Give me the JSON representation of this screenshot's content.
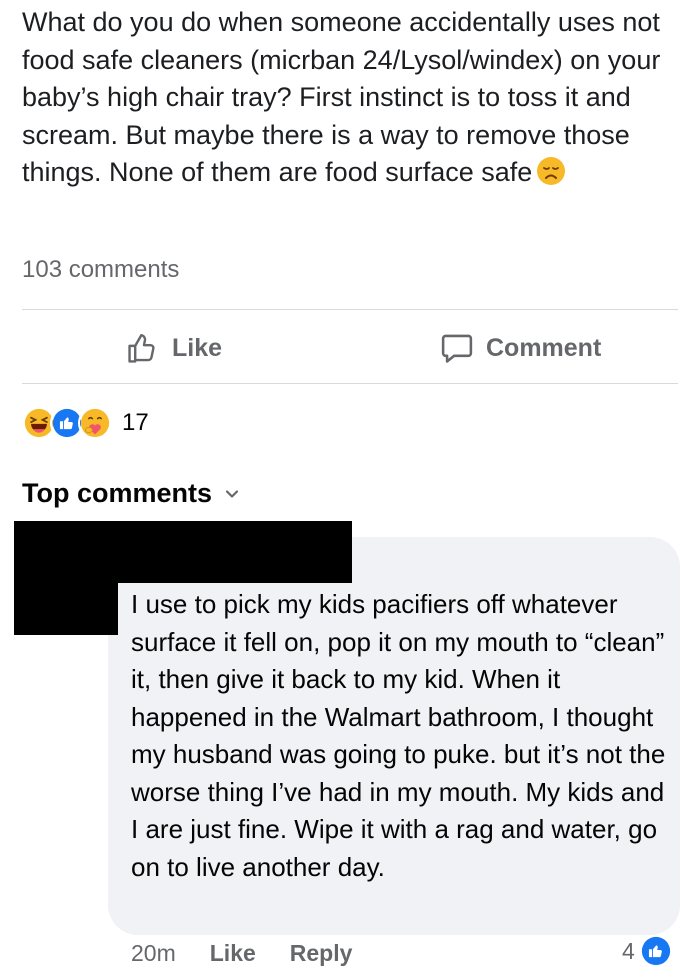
{
  "post": {
    "text": "What do you do when someone accidentally uses not food safe cleaners (micrban 24/Lysol/windex) on your baby’s high chair tray? First instinct is to toss it and scream. But maybe there is a way to remove those things. None of them are food surface safe",
    "emoji": "disappointed-face-emoji",
    "comment_count": "103 comments"
  },
  "actions": {
    "like_label": "Like",
    "comment_label": "Comment"
  },
  "reactions": {
    "icons": [
      "haha-reaction-icon",
      "like-reaction-icon",
      "care-reaction-icon"
    ],
    "count": "17"
  },
  "comments_section": {
    "heading": "Top comments"
  },
  "comment": {
    "author": "",
    "text": "I use to pick my kids pacifiers off whatever surface it fell on, pop it on my mouth to “clean” it, then give it back to my kid. When it happened in the Walmart bathroom, I thought my husband was going to puke. but it’s not the worse thing I’ve had in my mouth. My kids and I are just fine. Wipe it with a rag and water, go on to live another day.",
    "time": "20m",
    "like_label": "Like",
    "reply_label": "Reply",
    "reaction_count": "4"
  },
  "colors": {
    "text_primary": "#050505",
    "text_secondary": "#65676b",
    "bubble_background": "#f0f2f5",
    "like_blue": "#1877f2",
    "redaction": "#000000"
  }
}
